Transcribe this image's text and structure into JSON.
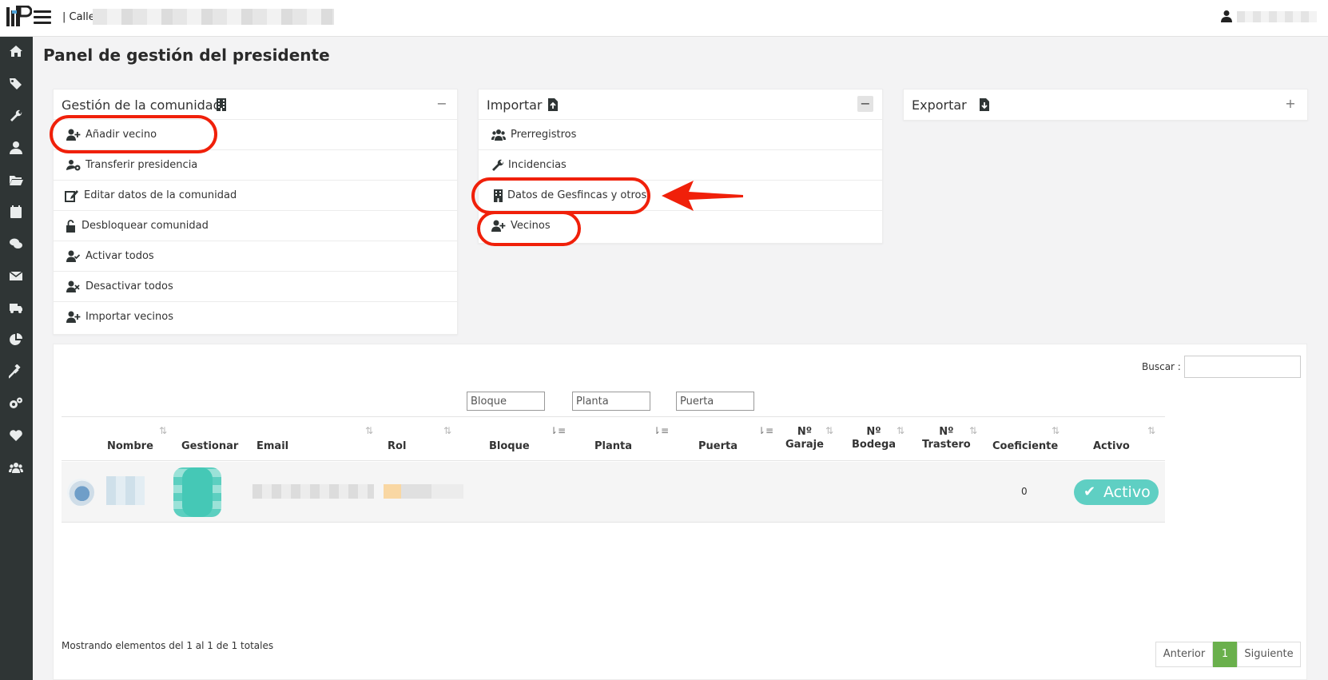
{
  "topbar": {
    "breadcrumb": "| Calle",
    "logo": "logo-icon",
    "menu_icon": "hamburger-icon",
    "user_icon": "user-icon"
  },
  "sidebar": {
    "icons": [
      "home-icon",
      "tags-icon",
      "wrench-icon",
      "user-icon",
      "folder-open-icon",
      "calendar-icon",
      "comments-icon",
      "envelope-icon",
      "truck-icon",
      "pie-chart-icon",
      "gavel-icon",
      "cogs-icon",
      "heart-icon",
      "users-icon"
    ],
    "background": "#2f3535"
  },
  "page": {
    "title": "Panel de gestión del presidente"
  },
  "panels": {
    "gestion": {
      "title": "Gestión de la comunidad",
      "toggle": "−",
      "items": [
        {
          "label": "Añadir vecino",
          "icon": "user-plus-icon"
        },
        {
          "label": "Transferir presidencia",
          "icon": "users-cog-icon"
        },
        {
          "label": "Editar datos de la comunidad",
          "icon": "edit-icon"
        },
        {
          "label": "Desbloquear comunidad",
          "icon": "unlock-icon"
        },
        {
          "label": "Activar todos",
          "icon": "user-check-icon"
        },
        {
          "label": "Desactivar todos",
          "icon": "user-times-icon"
        },
        {
          "label": "Importar vecinos",
          "icon": "user-plus-icon"
        }
      ]
    },
    "importar": {
      "title": "Importar",
      "toggle": "−",
      "items": [
        {
          "label": "Prerregistros",
          "icon": "users-icon"
        },
        {
          "label": "Incidencias",
          "icon": "wrench-icon"
        },
        {
          "label": "Datos de Gesfincas y otros",
          "icon": "building-icon"
        },
        {
          "label": "Vecinos",
          "icon": "user-plus-icon"
        }
      ]
    },
    "exportar": {
      "title": "Exportar",
      "toggle": "+"
    }
  },
  "table": {
    "search_label": "Buscar :",
    "filters": {
      "bloque": "Bloque",
      "planta": "Planta",
      "puerta": "Puerta"
    },
    "columns": {
      "nombre": "Nombre",
      "gestionar": "Gestionar",
      "email": "Email",
      "rol": "Rol",
      "bloque": "Bloque",
      "planta": "Planta",
      "puerta": "Puerta",
      "garaje_1": "Nº",
      "garaje_2": "Garaje",
      "bodega_1": "Nº",
      "bodega_2": "Bodega",
      "trastero_1": "Nº",
      "trastero_2": "Trastero",
      "coeficiente": "Coeficiente",
      "activo": "Activo"
    },
    "rows": [
      {
        "coeficiente": "0",
        "activo": "Activo"
      }
    ],
    "footer": "Mostrando elementos del 1 al 1 de 1 totales",
    "pagination": {
      "prev": "Anterior",
      "current": "1",
      "next": "Siguiente"
    }
  },
  "colors": {
    "callout": "#f0200a",
    "activo": "#5fcfc3",
    "page_current": "#6ab04c"
  }
}
